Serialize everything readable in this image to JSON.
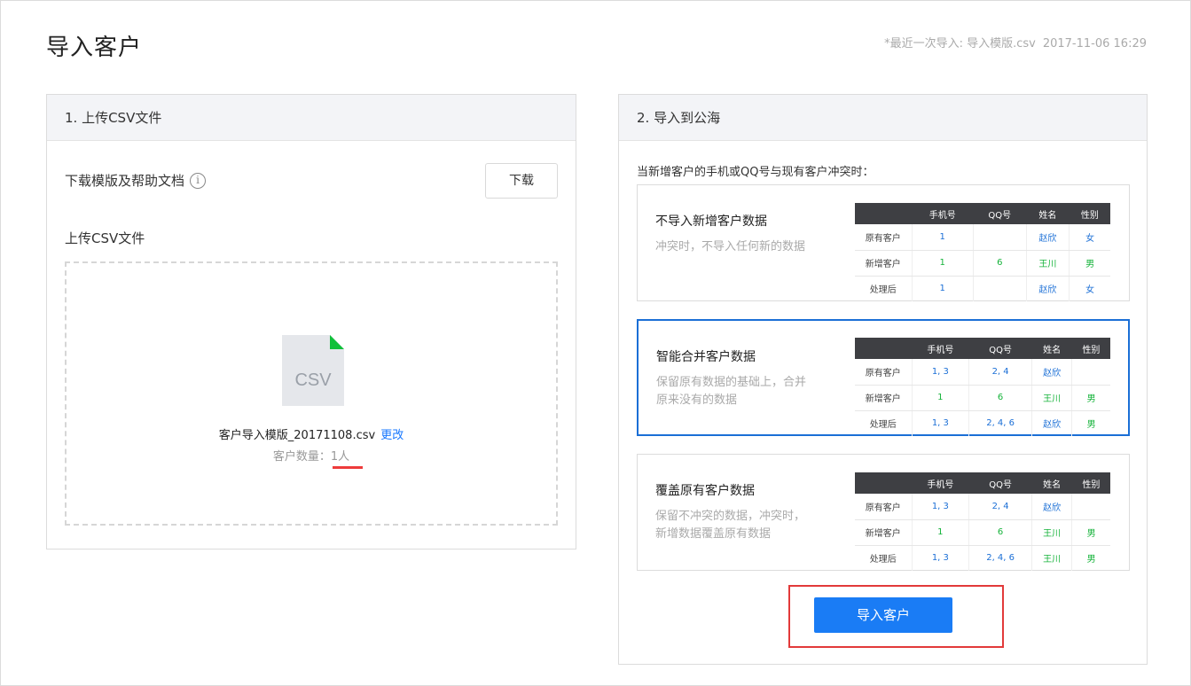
{
  "page": {
    "title": "导入客户",
    "last_import_label": "*最近一次导入: 导入模版.csv",
    "last_import_time": "2017-11-06 16:29"
  },
  "upload_panel": {
    "header": "1. 上传CSV文件",
    "download_label": "下载模版及帮助文档",
    "info_icon": "info-icon",
    "download_button": "下载",
    "upload_label": "上传CSV文件",
    "file_icon_text": "CSV",
    "file_name": "客户导入模版_20171108.csv",
    "change_link": "更改",
    "count_label": "客户数量：",
    "count_value": "1人"
  },
  "import_panel": {
    "header": "2. 导入到公海",
    "conflict_note": "当新增客户的手机或QQ号与现有客户冲突时：",
    "columns": [
      "",
      "手机号",
      "QQ号",
      "姓名",
      "性别"
    ],
    "options": [
      {
        "title": "不导入新增客户数据",
        "desc": "冲突时，不导入任何新的数据",
        "selected": false,
        "rows": [
          {
            "label": "原有客户",
            "phone": "1",
            "qq": "",
            "name": "赵欣",
            "gender": "女",
            "color": "blue"
          },
          {
            "label": "新增客户",
            "phone": "1",
            "qq": "6",
            "name": "王川",
            "gender": "男",
            "color": "green"
          },
          {
            "label": "处理后",
            "phone": "1",
            "qq": "",
            "name": "赵欣",
            "gender": "女",
            "color": "blue"
          }
        ]
      },
      {
        "title": "智能合并客户数据",
        "desc": "保留原有数据的基础上，合并原来没有的数据",
        "selected": true,
        "rows": [
          {
            "label": "原有客户",
            "phone": "1, 3",
            "qq": "2, 4",
            "name": "赵欣",
            "gender": "",
            "color": "blue"
          },
          {
            "label": "新增客户",
            "phone": "1",
            "qq": "6",
            "name": "王川",
            "gender": "男",
            "color": "green"
          },
          {
            "label": "处理后",
            "phone": "1, 3",
            "qq": "2, 4, 6",
            "name": "赵欣",
            "gender": "男",
            "color": "mixed"
          }
        ]
      },
      {
        "title": "覆盖原有客户数据",
        "desc": "保留不冲突的数据，冲突时，新增数据覆盖原有数据",
        "selected": false,
        "rows": [
          {
            "label": "原有客户",
            "phone": "1, 3",
            "qq": "2, 4",
            "name": "赵欣",
            "gender": "",
            "color": "blue"
          },
          {
            "label": "新增客户",
            "phone": "1",
            "qq": "6",
            "name": "王川",
            "gender": "男",
            "color": "green"
          },
          {
            "label": "处理后",
            "phone": "1, 3",
            "qq": "2, 4, 6",
            "name": "王川",
            "gender": "男",
            "color": "mixed2"
          }
        ]
      }
    ],
    "import_button": "导入客户"
  },
  "colors": {
    "accent": "#1a7cf5",
    "selected_border": "#1b6fd6",
    "blue_text": "#1b6fd6",
    "green_text": "#15b33a",
    "highlight_red": "#e23a3a",
    "table_header": "#3e3f43",
    "csv_corner": "#10c03a"
  }
}
